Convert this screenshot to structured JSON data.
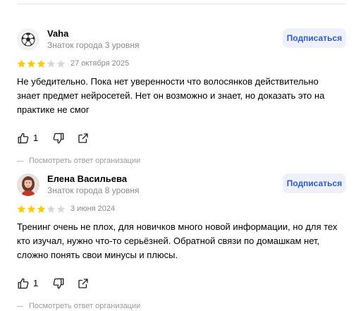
{
  "reviews": [
    {
      "author": "Vaha",
      "level": "Знаток города 3 уровня",
      "subscribe_label": "Подписаться",
      "rating": 3,
      "date": "27 октября 2025",
      "text": "Не убедительно. Пока нет уверенности что волосянков действительно знает предмет нейросетей. Нет он возможно и знает, но доказать это на практике не смог",
      "likes": "1",
      "org_reply_label": "Посмотреть ответ организации",
      "avatar_icon": "soccer-ball-icon"
    },
    {
      "author": "Елена Васильева",
      "level": "Знаток города 8 уровня",
      "subscribe_label": "Подписаться",
      "rating": 3,
      "date": "3 июня 2024",
      "text": "Тренинг очень не плох, для новичков много новой информации, но для тех кто изучал, нужно что-то серьёзней. Обратной связи по домашкам нет, сложно понять свои минусы и плюсы.",
      "likes": "1",
      "org_reply_label": "Посмотреть ответ организации",
      "avatar_icon": "user-photo"
    }
  ],
  "colors": {
    "star_filled": "#fc0",
    "star_empty": "#d9d9d9",
    "button_bg": "#eef1fb",
    "button_text": "#2c5bd4"
  }
}
